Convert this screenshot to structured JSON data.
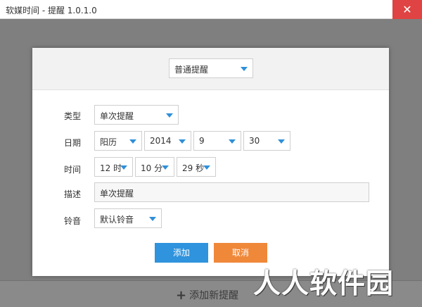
{
  "window": {
    "title": "软媒时间 - 提醒 1.0.1.0",
    "close_glyph": "✕"
  },
  "dialog": {
    "mode_select": "普通提醒",
    "rows": {
      "type": {
        "label": "类型",
        "value": "单次提醒"
      },
      "date": {
        "label": "日期",
        "calendar": "阳历",
        "year": "2014",
        "month": "9",
        "day": "30"
      },
      "time": {
        "label": "时间",
        "hour": "12 时",
        "minute": "10 分",
        "second": "29 秒"
      },
      "desc": {
        "label": "描述",
        "value": "单次提醒"
      },
      "ringtone": {
        "label": "铃音",
        "value": "默认铃音"
      }
    },
    "buttons": {
      "ok": "添加",
      "cancel": "取消"
    }
  },
  "footer": {
    "add_new_plus": "+",
    "add_new": "添加新提醒"
  },
  "watermark": "人人软件园",
  "colors": {
    "accent": "#2f93dd",
    "cancel": "#f0883a",
    "close": "#e04343"
  }
}
